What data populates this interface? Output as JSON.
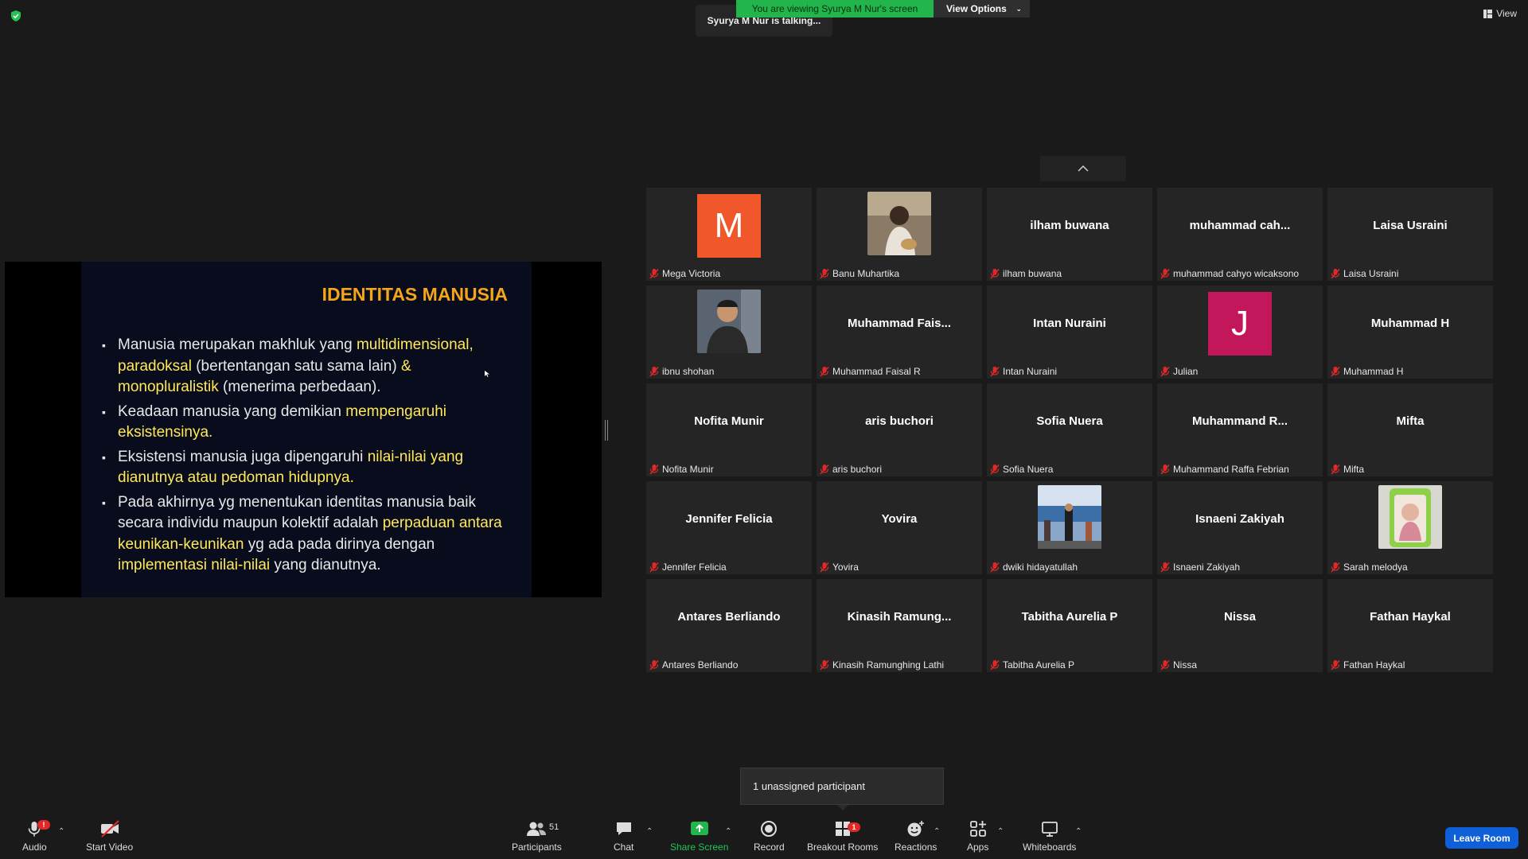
{
  "topbar": {
    "view_label": "View",
    "talking": "Syurya M Nur is talking...",
    "viewing": "You are viewing Syurya M Nur's screen",
    "view_options": "View Options"
  },
  "slide": {
    "title": "IDENTITAS MANUSIA",
    "bullets": [
      [
        {
          "t": "Manusia merupakan makhluk yang ",
          "h": false
        },
        {
          "t": "multidimensional, paradoksal",
          "h": true
        },
        {
          "t": " (bertentangan satu sama lain) ",
          "h": false
        },
        {
          "t": "& monopluralistik",
          "h": true
        },
        {
          "t": " (menerima perbedaan).",
          "h": false
        }
      ],
      [
        {
          "t": "Keadaan manusia yang demikian ",
          "h": false
        },
        {
          "t": "mempengaruhi eksistensinya.",
          "h": true
        }
      ],
      [
        {
          "t": "Eksistensi manusia juga dipengaruhi ",
          "h": false
        },
        {
          "t": "nilai-nilai yang dianutnya atau pedoman hidupnya.",
          "h": true
        }
      ],
      [
        {
          "t": "Pada akhirnya yg menentukan identitas manusia baik secara individu maupun kolektif adalah ",
          "h": false
        },
        {
          "t": "perpaduan antara keunikan-keunikan",
          "h": true
        },
        {
          "t": " yg ada pada dirinya dengan ",
          "h": false
        },
        {
          "t": "implementasi nilai-nilai",
          "h": true
        },
        {
          "t": " yang dianutnya.",
          "h": false
        }
      ]
    ]
  },
  "participants": [
    {
      "label": "Mega Victoria",
      "avatar_letter": "M",
      "avatar_color": "#f0572a"
    },
    {
      "label": "Banu Muhartika",
      "photo": "photo-woman-guitar"
    },
    {
      "label": "ilham buwana",
      "display": "ilham buwana"
    },
    {
      "label": "muhammad cahyo wicaksono",
      "display": "muhammad cah..."
    },
    {
      "label": "Laisa Usraini",
      "display": "Laisa Usraini"
    },
    {
      "label": "ibnu shohan",
      "photo": "photo-man-portrait"
    },
    {
      "label": "Muhammad Faisal R",
      "display": "Muhammad Fais..."
    },
    {
      "label": "Intan Nuraini",
      "display": "Intan Nuraini"
    },
    {
      "label": "Julian",
      "avatar_letter": "J",
      "avatar_color": "#c2185b"
    },
    {
      "label": "Muhammad H",
      "display": "Muhammad H"
    },
    {
      "label": "Nofita Munir",
      "display": "Nofita Munir"
    },
    {
      "label": "aris buchori",
      "display": "aris buchori"
    },
    {
      "label": "Sofia Nuera",
      "display": "Sofia Nuera"
    },
    {
      "label": "Muhammand Raffa Febrian",
      "display": "Muhammand R..."
    },
    {
      "label": "Mifta",
      "display": "Mifta"
    },
    {
      "label": "Jennifer Felicia",
      "display": "Jennifer Felicia"
    },
    {
      "label": "Yovira",
      "display": "Yovira"
    },
    {
      "label": "dwiki hidayatullah",
      "photo": "photo-crowd"
    },
    {
      "label": "Isnaeni Zakiyah",
      "display": "Isnaeni Zakiyah"
    },
    {
      "label": "Sarah melodya",
      "photo": "photo-baby-green"
    },
    {
      "label": "Antares Berliando",
      "display": "Antares Berliando"
    },
    {
      "label": "Kinasih Ramunghing Lathi",
      "display": "Kinasih  Ramung..."
    },
    {
      "label": "Tabitha Aurelia P",
      "display": "Tabitha Aurelia P"
    },
    {
      "label": "Nissa",
      "display": "Nissa"
    },
    {
      "label": "Fathan Haykal",
      "display": "Fathan Haykal"
    }
  ],
  "popup": {
    "unassigned": "1 unassigned participant"
  },
  "toolbar": {
    "audio": "Audio",
    "audio_badge": "!",
    "start_video": "Start Video",
    "participants": "Participants",
    "participants_count": "51",
    "chat": "Chat",
    "share_screen": "Share Screen",
    "record": "Record",
    "breakout_rooms": "Breakout Rooms",
    "breakout_badge": "1",
    "reactions": "Reactions",
    "apps": "Apps",
    "whiteboards": "Whiteboards",
    "leave_room": "Leave Room"
  },
  "colors": {
    "share_green": "#21b54b",
    "leave_blue": "#0e5fd8",
    "slide_title": "#f5a51a",
    "slide_highlight": "#ffe85a",
    "mic_muted": "#e02828"
  }
}
